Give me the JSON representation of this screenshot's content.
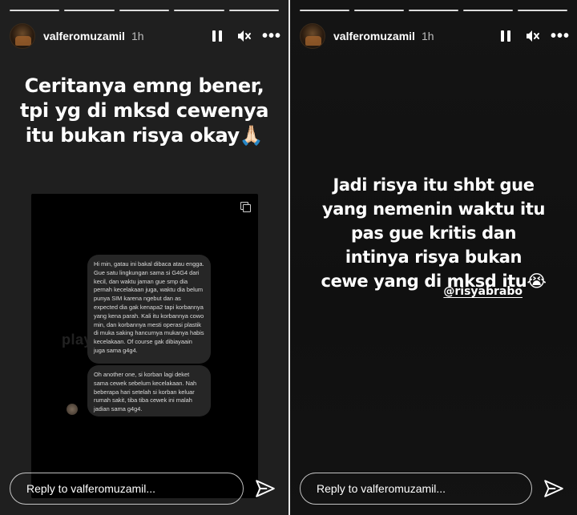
{
  "stories": [
    {
      "user": {
        "username": "valferomuzamil",
        "time": "1h"
      },
      "caption": [
        "Ceritanya emng bener,",
        "tpi yg di mksd cewenya",
        "itu bukan risya okay🙏🏻"
      ],
      "screenshot": {
        "watermark": "playground.official",
        "messages": [
          "Hi min, gatau ini bakal dibaca atau engga. Gue satu lingkungan sama si G4G4 dari kecil, dan waktu jaman gue smp dia pernah kecelakaan juga, waktu dia belum punya SIM karena ngebut dan as expected dia gak kenapa2 tapi korbannya yang kena parah. Kali itu korbannya cowo min, dan korbannya mesti operasi plastik di muka saking hancurnya mukanya habis kecelakaan. Of course gak dibiayaain juga sama g4g4.",
          "Oh another one, si korban lagi deket sama cewek sebelum kecelakaan. Nah beberapa hari setelah si korban keluar rumah sakit, tiba tiba cewek ini malah jadian sama g4g4."
        ]
      },
      "reply_placeholder": "Reply to valferomuzamil..."
    },
    {
      "user": {
        "username": "valferomuzamil",
        "time": "1h"
      },
      "caption": [
        "Jadi risya itu shbt gue",
        "yang nemenin waktu itu",
        "pas gue kritis dan",
        "intinya risya bukan",
        "cewe yang di mksd itu😭"
      ],
      "mention": "@risyabrabo",
      "reply_placeholder": "Reply to valferomuzamil..."
    }
  ],
  "colors": {
    "story_bg": "#1f1f1f",
    "text": "#ffffff",
    "bubble": "#262626"
  },
  "icons": [
    "pause-icon",
    "mute-icon",
    "more-icon",
    "send-icon",
    "copy-icon"
  ]
}
